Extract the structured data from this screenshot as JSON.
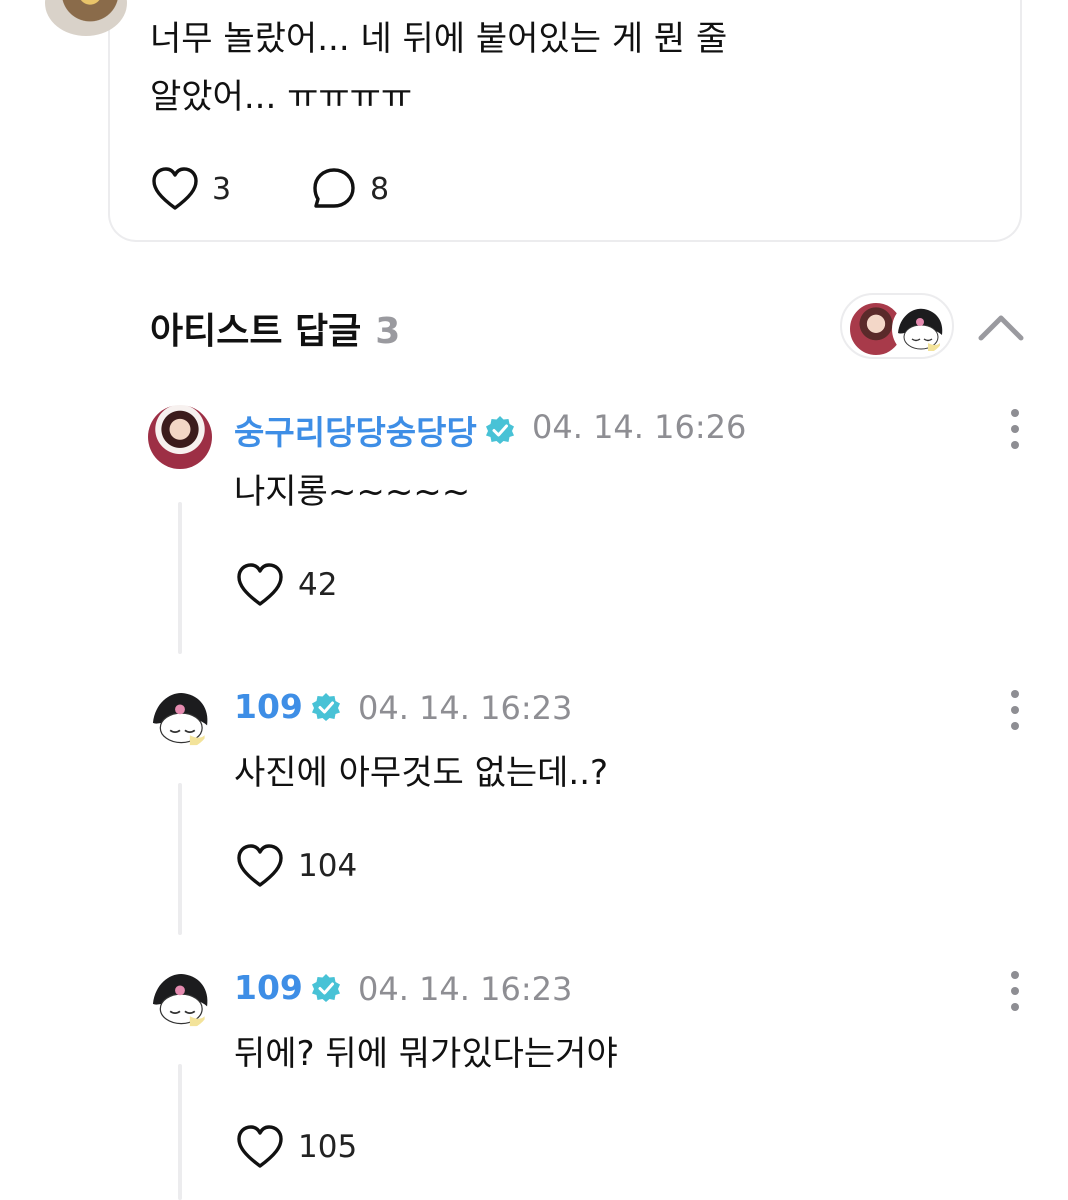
{
  "post": {
    "text_line1": "너무 놀랐어... 네 뒤에 붙어있는 게 뭔 줄",
    "text_line2": "알았어... ㅠㅠㅠㅠ",
    "like_count": "3",
    "comment_count": "8"
  },
  "artist_replies": {
    "title": "아티스트 답글",
    "count": "3"
  },
  "replies": [
    {
      "name": "숭구리당당숭당당",
      "time": "04. 14. 16:26",
      "text": "나지롱~~~~~",
      "likes": "42"
    },
    {
      "name": "109",
      "time": "04. 14. 16:23",
      "text": "사진에 아무것도 없는데..?",
      "likes": "104"
    },
    {
      "name": "109",
      "time": "04. 14. 16:23",
      "text": "뒤에? 뒤에 뭐가있다는거야",
      "likes": "105"
    }
  ],
  "icons": {
    "like": "heart-outline-icon",
    "comment": "speech-bubble-icon",
    "verified": "verified-badge-icon",
    "more": "more-vertical-icon",
    "collapse": "chevron-up-icon"
  },
  "colors": {
    "name_blue": "#3e8ee6",
    "verified_teal": "#48c2d6",
    "muted_gray": "#8e8e93"
  }
}
